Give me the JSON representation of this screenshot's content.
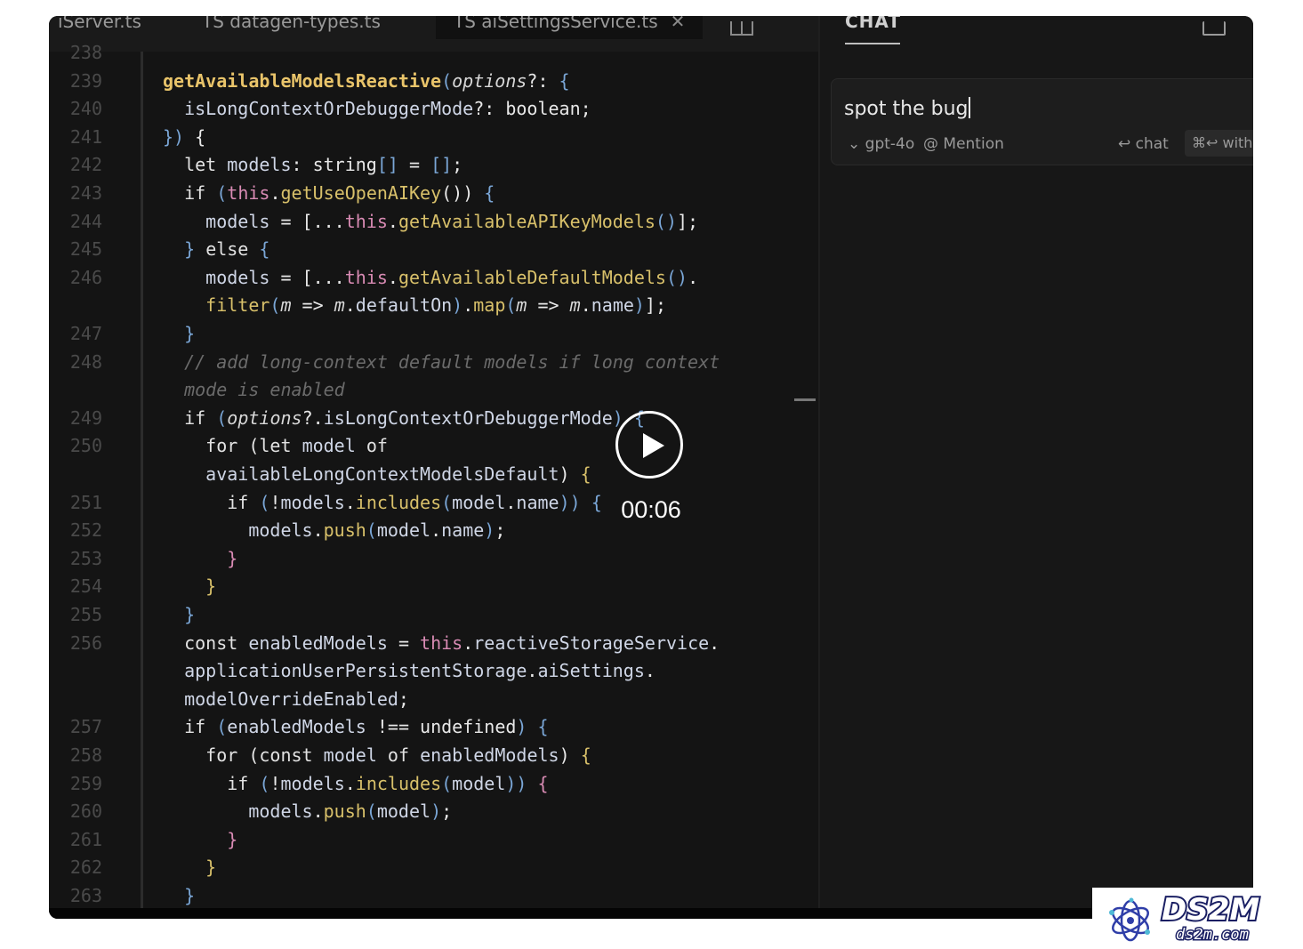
{
  "editor": {
    "tabs": [
      {
        "label": "iServer.ts"
      },
      {
        "label": "TS datagen-types.ts"
      },
      {
        "label": "TS aiSettingsService.ts",
        "close": "✕"
      }
    ],
    "code_lines": [
      {
        "n": "238",
        "html": ""
      },
      {
        "n": "239",
        "html": "<span class='fn'>getAvailableModelsReactive</span><span class='par'>(</span><span class='ital'>options</span><span class='punc'>?: </span><span class='par'>{</span>"
      },
      {
        "n": "240",
        "html": "  <span class='prop'>isLongContextOrDebuggerMode</span><span class='punc'>?: boolean;</span>"
      },
      {
        "n": "241",
        "html": "<span class='par'>})</span><span class='punc'> {</span>"
      },
      {
        "n": "242",
        "html": "  <span class='k'>let</span> <span class='prop'>models</span><span class='punc'>: string</span><span class='par'>[]</span><span class='punc'> = </span><span class='par'>[]</span><span class='punc'>;</span>"
      },
      {
        "n": "243",
        "html": "  <span class='k'>if</span> <span class='par'>(</span><span class='this'>this</span><span class='punc'>.</span><span class='fn2'>getUseOpenAIKey</span><span class='punc'>())</span> <span class='par'>{</span>"
      },
      {
        "n": "244",
        "html": "    <span class='prop'>models</span><span class='punc'> = [...</span><span class='this'>this</span><span class='punc'>.</span><span class='fn2'>getAvailableAPIKeyModels</span><span class='par'>()</span><span class='punc'>];</span>"
      },
      {
        "n": "245",
        "html": "  <span class='par'>}</span> <span class='k'>else</span> <span class='par'>{</span>"
      },
      {
        "n": "246",
        "html": "    <span class='prop'>models</span><span class='punc'> = [...</span><span class='this'>this</span><span class='punc'>.</span><span class='fn2'>getAvailableDefaultModels</span><span class='par'>()</span><span class='punc'>.</span>"
      },
      {
        "n": "",
        "html": "    <span class='fn2'>filter</span><span class='par'>(</span><span class='ital'>m</span><span class='punc'> =&gt; </span><span class='ital'>m</span><span class='punc'>.</span><span class='prop'>defaultOn</span><span class='par'>)</span><span class='punc'>.</span><span class='fn2'>map</span><span class='par'>(</span><span class='ital'>m</span><span class='punc'> =&gt; </span><span class='ital'>m</span><span class='punc'>.</span><span class='prop'>name</span><span class='par'>)</span><span class='punc'>];</span>"
      },
      {
        "n": "247",
        "html": "  <span class='par'>}</span>"
      },
      {
        "n": "248",
        "html": "  <span class='com'>// add long-context default models if long context</span>"
      },
      {
        "n": "",
        "html": "  <span class='com'>mode is enabled</span>"
      },
      {
        "n": "249",
        "html": "  <span class='k'>if</span> <span class='par'>(</span><span class='ital'>options</span><span class='punc'>?.</span><span class='prop'>isLongContextOrDebuggerMode</span><span class='par'>)</span> <span class='par'>{</span>"
      },
      {
        "n": "250",
        "html": "    <span class='k'>for</span> <span class='punc'>(</span><span class='k'>let</span> <span class='prop'>model</span> <span class='k'>of</span>"
      },
      {
        "n": "",
        "html": "    <span class='prop'>availableLongContextModelsDefault</span><span class='punc'>)</span> <span class='fn2'>{</span>"
      },
      {
        "n": "251",
        "html": "      <span class='k'>if</span> <span class='par'>(</span><span class='punc'>!</span><span class='prop'>models</span><span class='punc'>.</span><span class='fn2'>includes</span><span class='par'>(</span><span class='prop'>model</span><span class='punc'>.</span><span class='prop'>name</span><span class='par'>))</span> <span class='par'>{</span>"
      },
      {
        "n": "252",
        "html": "        <span class='prop'>models</span><span class='punc'>.</span><span class='fn2'>push</span><span class='par'>(</span><span class='prop'>model</span><span class='punc'>.</span><span class='prop'>name</span><span class='par'>)</span><span class='punc'>;</span>"
      },
      {
        "n": "253",
        "html": "      <span class='this'>}</span>"
      },
      {
        "n": "254",
        "html": "    <span class='fn2'>}</span>"
      },
      {
        "n": "255",
        "html": "  <span class='par'>}</span>"
      },
      {
        "n": "256",
        "html": "  <span class='k'>const</span> <span class='prop'>enabledModels</span><span class='punc'> = </span><span class='this'>this</span><span class='punc'>.</span><span class='prop'>reactiveStorageService</span><span class='punc'>.</span>"
      },
      {
        "n": "",
        "html": "  <span class='prop'>applicationUserPersistentStorage</span><span class='punc'>.</span><span class='prop'>aiSettings</span><span class='punc'>.</span>"
      },
      {
        "n": "",
        "html": "  <span class='prop'>modelOverrideEnabled</span><span class='punc'>;</span>"
      },
      {
        "n": "257",
        "html": "  <span class='k'>if</span> <span class='par'>(</span><span class='prop'>enabledModels</span><span class='punc'> !== undefined</span><span class='par'>)</span> <span class='par'>{</span>"
      },
      {
        "n": "258",
        "html": "    <span class='k'>for</span> <span class='punc'>(</span><span class='k'>const</span> <span class='prop'>model</span> <span class='k'>of</span> <span class='prop'>enabledModels</span><span class='punc'>)</span> <span class='fn2'>{</span>"
      },
      {
        "n": "259",
        "html": "      <span class='k'>if</span> <span class='par'>(</span><span class='punc'>!</span><span class='prop'>models</span><span class='punc'>.</span><span class='fn2'>includes</span><span class='par'>(</span><span class='prop'>model</span><span class='par'>))</span> <span class='this'>{</span>"
      },
      {
        "n": "260",
        "html": "        <span class='prop'>models</span><span class='punc'>.</span><span class='fn2'>push</span><span class='par'>(</span><span class='prop'>model</span><span class='par'>)</span><span class='punc'>;</span>"
      },
      {
        "n": "261",
        "html": "      <span class='this'>}</span>"
      },
      {
        "n": "262",
        "html": "    <span class='fn2'>}</span>"
      },
      {
        "n": "263",
        "html": "  <span class='par'>}</span>"
      }
    ]
  },
  "chat": {
    "title": "CHAT",
    "input_value": "spot the bug",
    "model_label": "gpt-4o",
    "model_chevron": "⌄",
    "mention_label": "@ Mention",
    "chat_label": "↩ chat",
    "kbd_label": "⌘↩ with"
  },
  "player": {
    "timecode": "00:06",
    "play_icon": "play-icon"
  },
  "watermark": {
    "brand": "DS2M",
    "domain": "ds2m.com"
  },
  "colors": {
    "editor_bg": "#141414",
    "function": "#e9c46a",
    "keyword": "#e2e2e2",
    "this": "#d98bb4",
    "comment": "#6b6b6b"
  }
}
